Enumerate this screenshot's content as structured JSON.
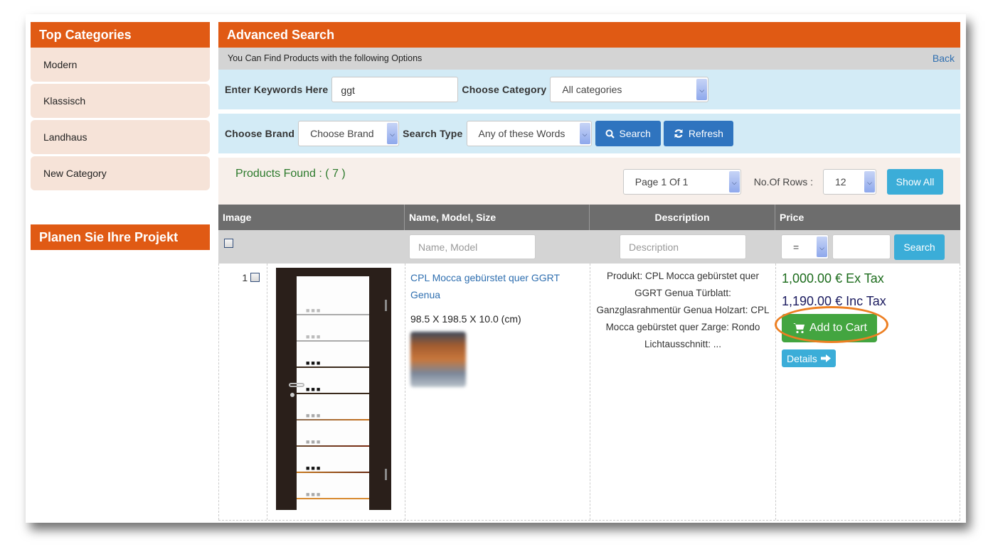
{
  "sidebar": {
    "top_categories_title": "Top Categories",
    "categories": [
      {
        "label": "Modern"
      },
      {
        "label": "Klassisch"
      },
      {
        "label": "Landhaus"
      },
      {
        "label": "New Category"
      }
    ],
    "projekt_title": "Planen Sie Ihre Projekt"
  },
  "advanced_search": {
    "title": "Advanced Search",
    "subtitle": "You Can Find Products with the following Options",
    "back_label": "Back",
    "keywords_label": "Enter Keywords Here",
    "keywords_value": "ggt",
    "category_label": "Choose Category",
    "category_value": "All categories",
    "brand_label": "Choose Brand",
    "brand_value": "Choose Brand",
    "search_type_label": "Search Type",
    "search_type_value": "Any of these Words",
    "search_button": "Search",
    "refresh_button": "Refresh"
  },
  "results": {
    "found_text": "Products Found : ( 7 )",
    "page_value": "Page 1 Of 1",
    "rows_label": "No.Of Rows  :",
    "rows_value": "12",
    "show_all_button": "Show All"
  },
  "table": {
    "headers": [
      "Image",
      "Name, Model, Size",
      "Description",
      "Price"
    ],
    "filter": {
      "name_placeholder": "Name, Model",
      "description_placeholder": "Description",
      "price_operator": "=",
      "price_value": "",
      "search_button": "Search"
    },
    "rows": [
      {
        "index": "1",
        "name": "CPL Mocca gebürstet quer GGRT Genua",
        "size": "98.5 X 198.5 X 10.0 (cm)",
        "description": "Produkt: CPL Mocca gebürstet quer GGRT Genua Türblatt: Ganzglasrahmentür Genua Holzart: CPL Mocca gebürstet quer Zarge: Rondo Lichtausschnitt: ...",
        "price_ex_tax": "1,000.00 € Ex Tax",
        "price_inc_tax": "1,190.00 € Inc Tax",
        "add_to_cart_label": "Add to Cart",
        "details_label": "Details"
      }
    ]
  },
  "colors": {
    "brand_orange": "#e05a14",
    "highlight_ring": "#ed7f22",
    "cart_green": "#43a540",
    "primary_blue": "#2f74bf",
    "info_cyan": "#3badd8"
  }
}
